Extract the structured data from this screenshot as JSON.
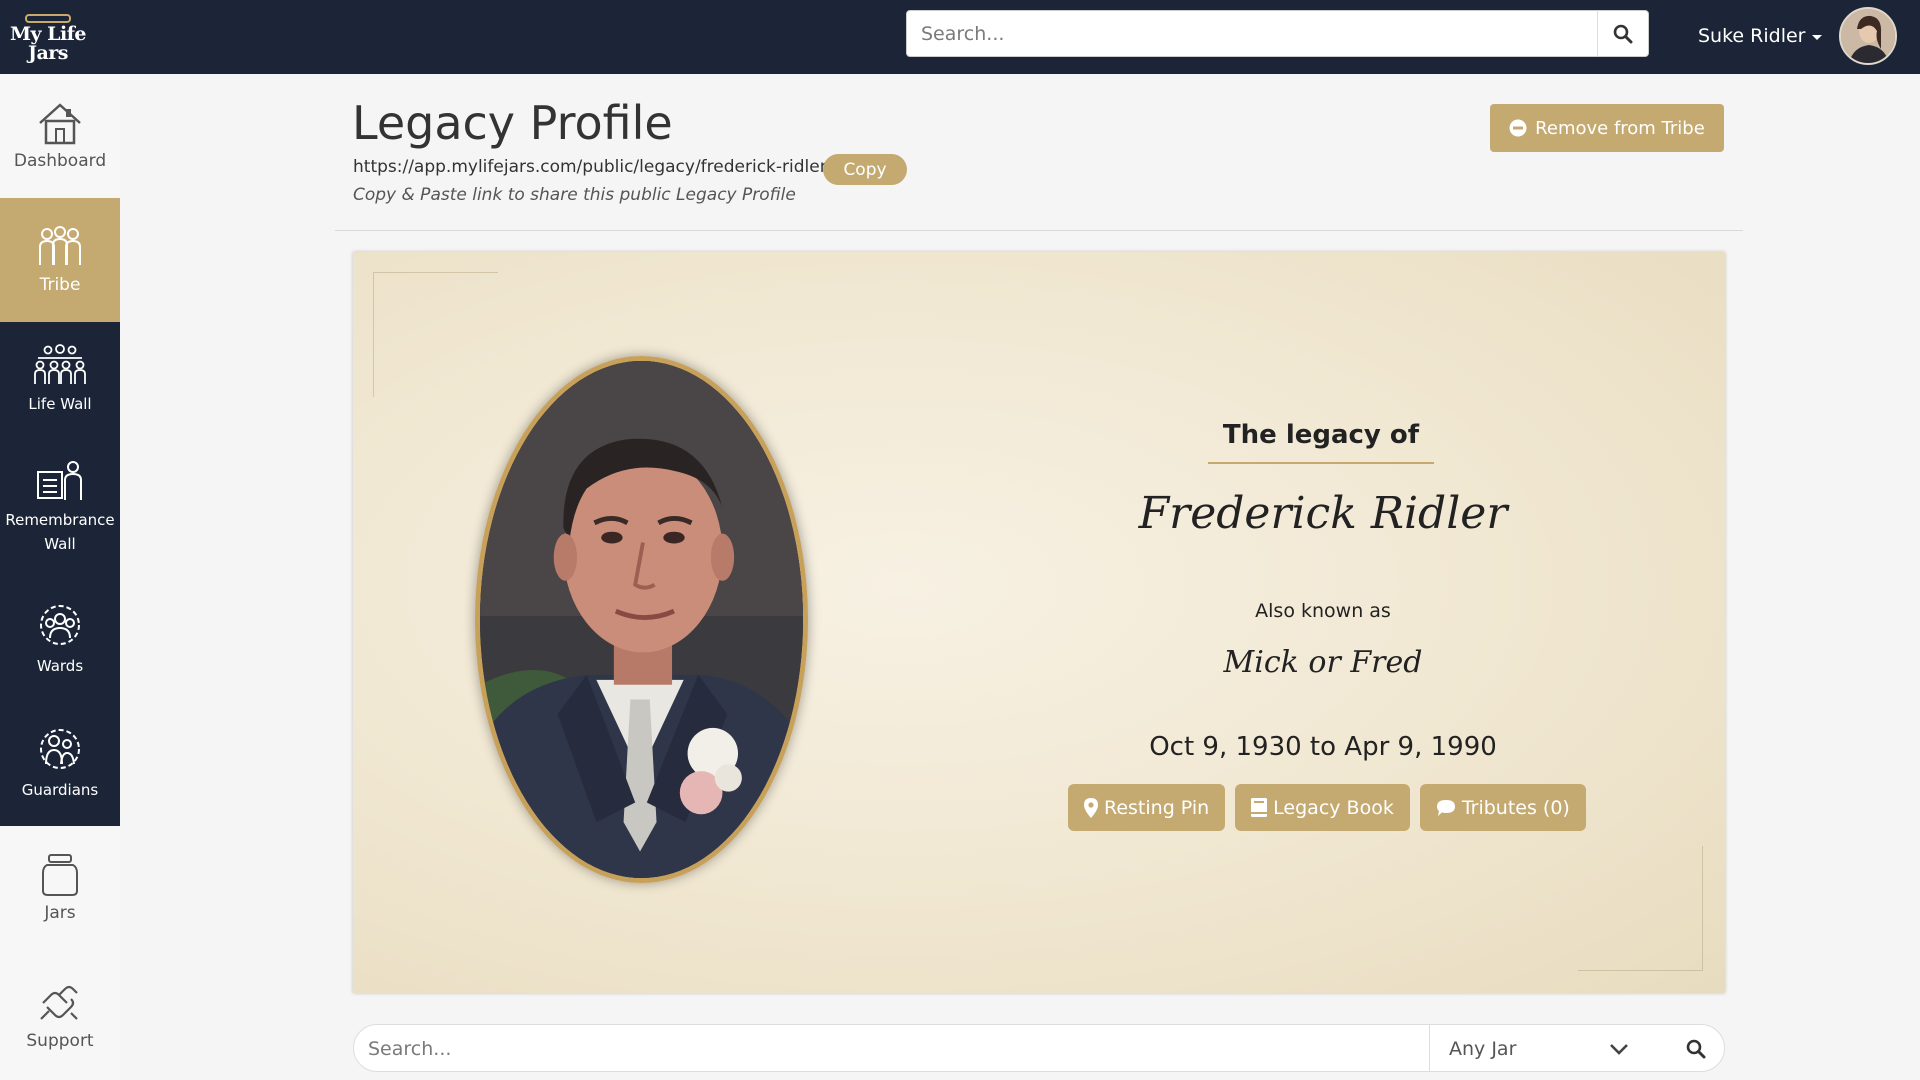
{
  "app": {
    "logo_text_line1": "My Life",
    "logo_text_line2": "Jars"
  },
  "header": {
    "search_placeholder": "Search...",
    "user_name": "Suke Ridler"
  },
  "sidebar": {
    "items": [
      {
        "label": "Dashboard",
        "icon": "house-icon"
      },
      {
        "label": "Tribe",
        "icon": "tribe-icon",
        "active": true
      },
      {
        "label": "Life Wall",
        "icon": "family-tree-icon"
      },
      {
        "label": "Remembrance Wall",
        "icon": "memorial-icon"
      },
      {
        "label": "Wards",
        "icon": "wards-icon"
      },
      {
        "label": "Guardians",
        "icon": "guardians-icon"
      },
      {
        "label": "Jars",
        "icon": "jar-icon"
      },
      {
        "label": "Support",
        "icon": "support-icon"
      }
    ]
  },
  "page": {
    "title": "Legacy Profile",
    "url": "https://app.mylifejars.com/public/legacy/frederick-ridler",
    "copy_label": "Copy",
    "share_note": "Copy & Paste link to share this public Legacy Profile",
    "remove_label": "Remove from Tribe"
  },
  "legacy": {
    "heading": "The legacy of",
    "name": "Frederick Ridler",
    "aka_label": "Also known as",
    "aka_value": "Mick or Fred",
    "dates": "Oct 9, 1930 to Apr 9, 1990",
    "buttons": {
      "resting_pin": "Resting Pin",
      "legacy_book": "Legacy Book",
      "tributes": "Tributes (0)"
    }
  },
  "bottom_search": {
    "placeholder": "Search...",
    "jar_filter": "Any Jar"
  },
  "colors": {
    "navy": "#1b2537",
    "gold": "#c4aa71",
    "frame_gold": "#c7a15a"
  }
}
